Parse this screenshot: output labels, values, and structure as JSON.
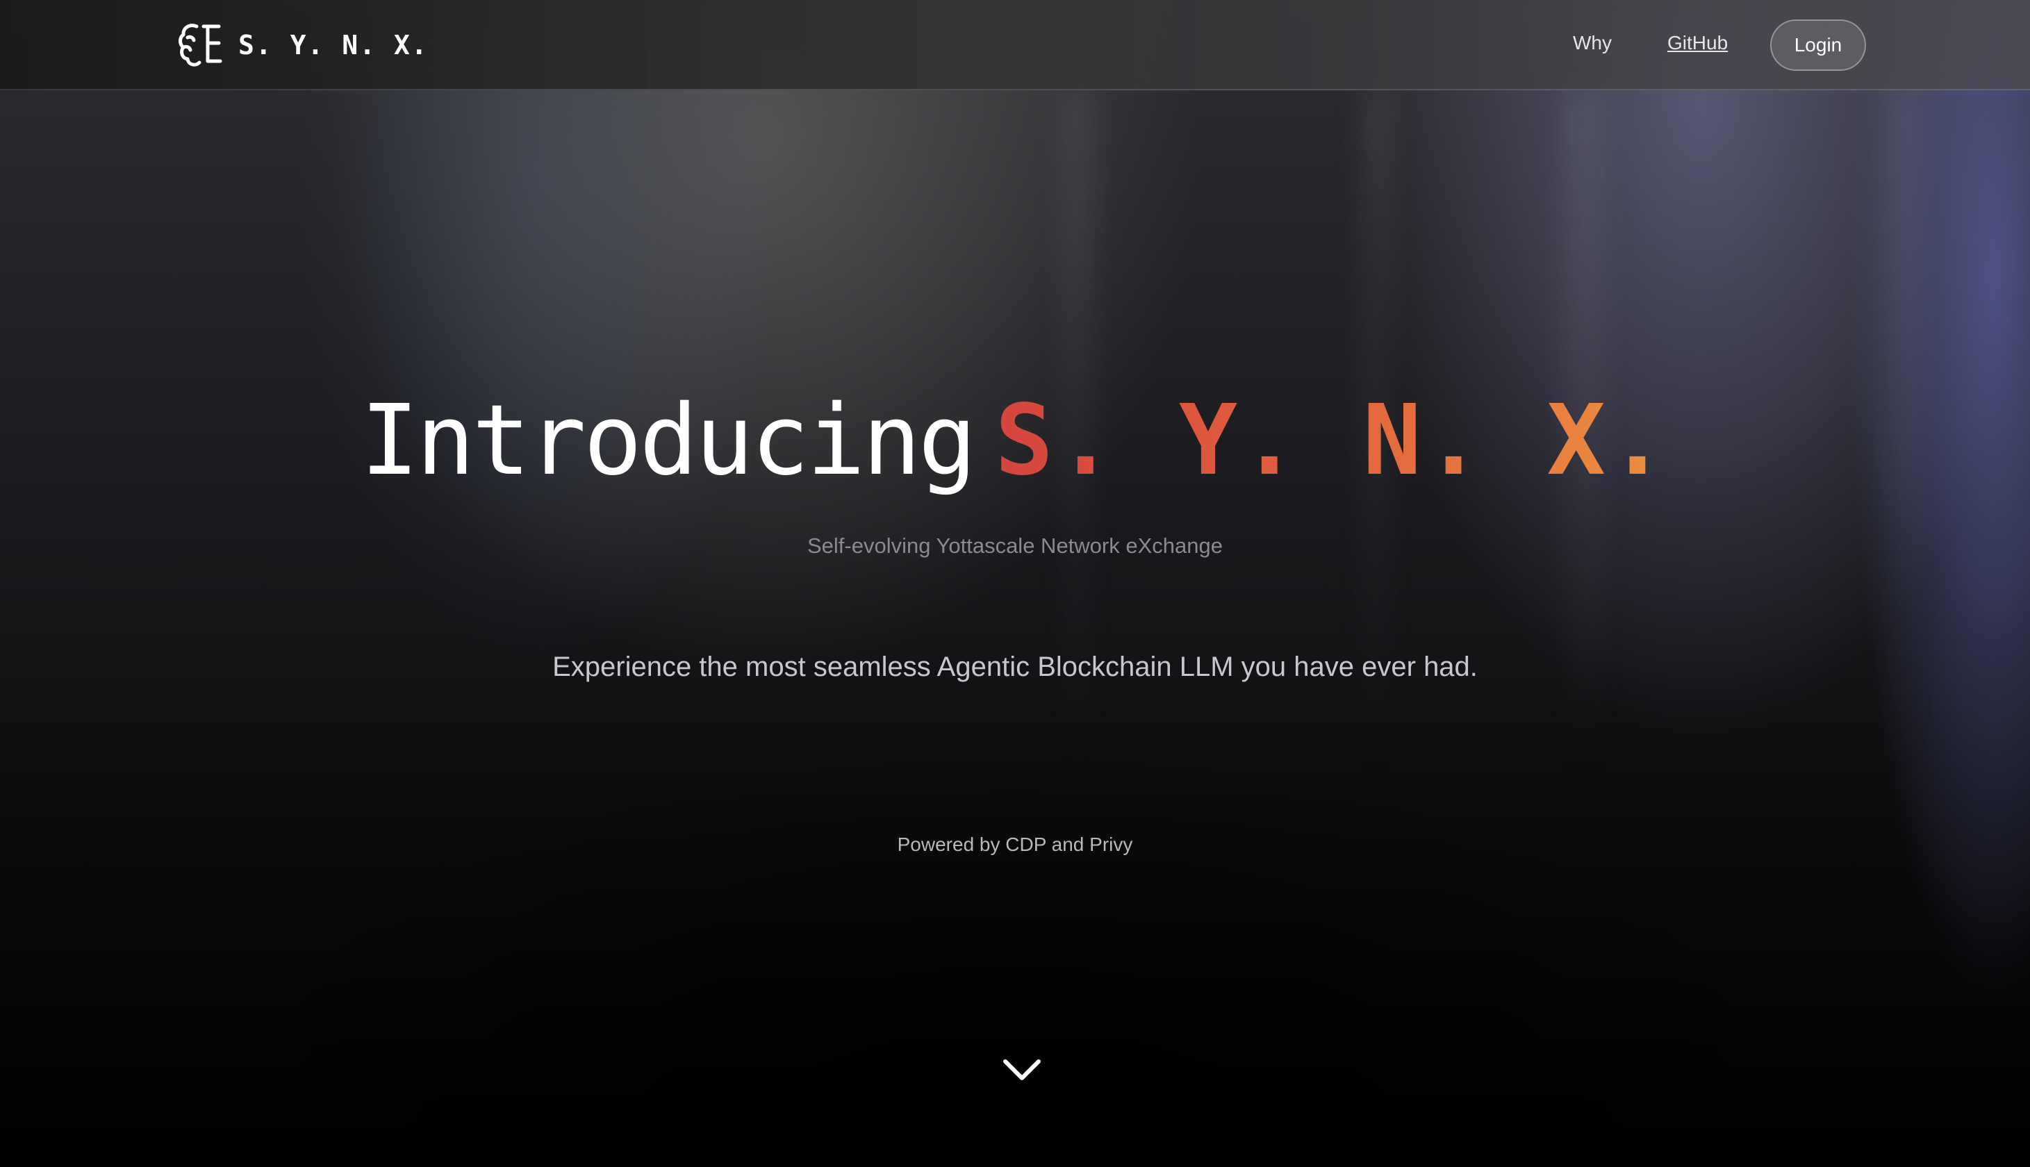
{
  "brand": {
    "name": "S. Y. N. X.",
    "logo_icon": "brain-letter-icon"
  },
  "nav": {
    "items": [
      {
        "label": "Why"
      },
      {
        "label": "GitHub"
      }
    ],
    "login_label": "Login"
  },
  "hero": {
    "intro": "Introducing",
    "brand": "S. Y. N. X.",
    "subtitle": "Self-evolving Yottascale Network eXchange",
    "tagline": "Experience the most seamless Agentic Blockchain LLM you have ever had.",
    "powered_by": "Powered by CDP and Privy",
    "scroll_icon": "chevron-down-icon"
  },
  "colors": {
    "brand_gradient_start": "#d4453f",
    "brand_gradient_end": "#ec8f3f",
    "background": "#000000"
  }
}
